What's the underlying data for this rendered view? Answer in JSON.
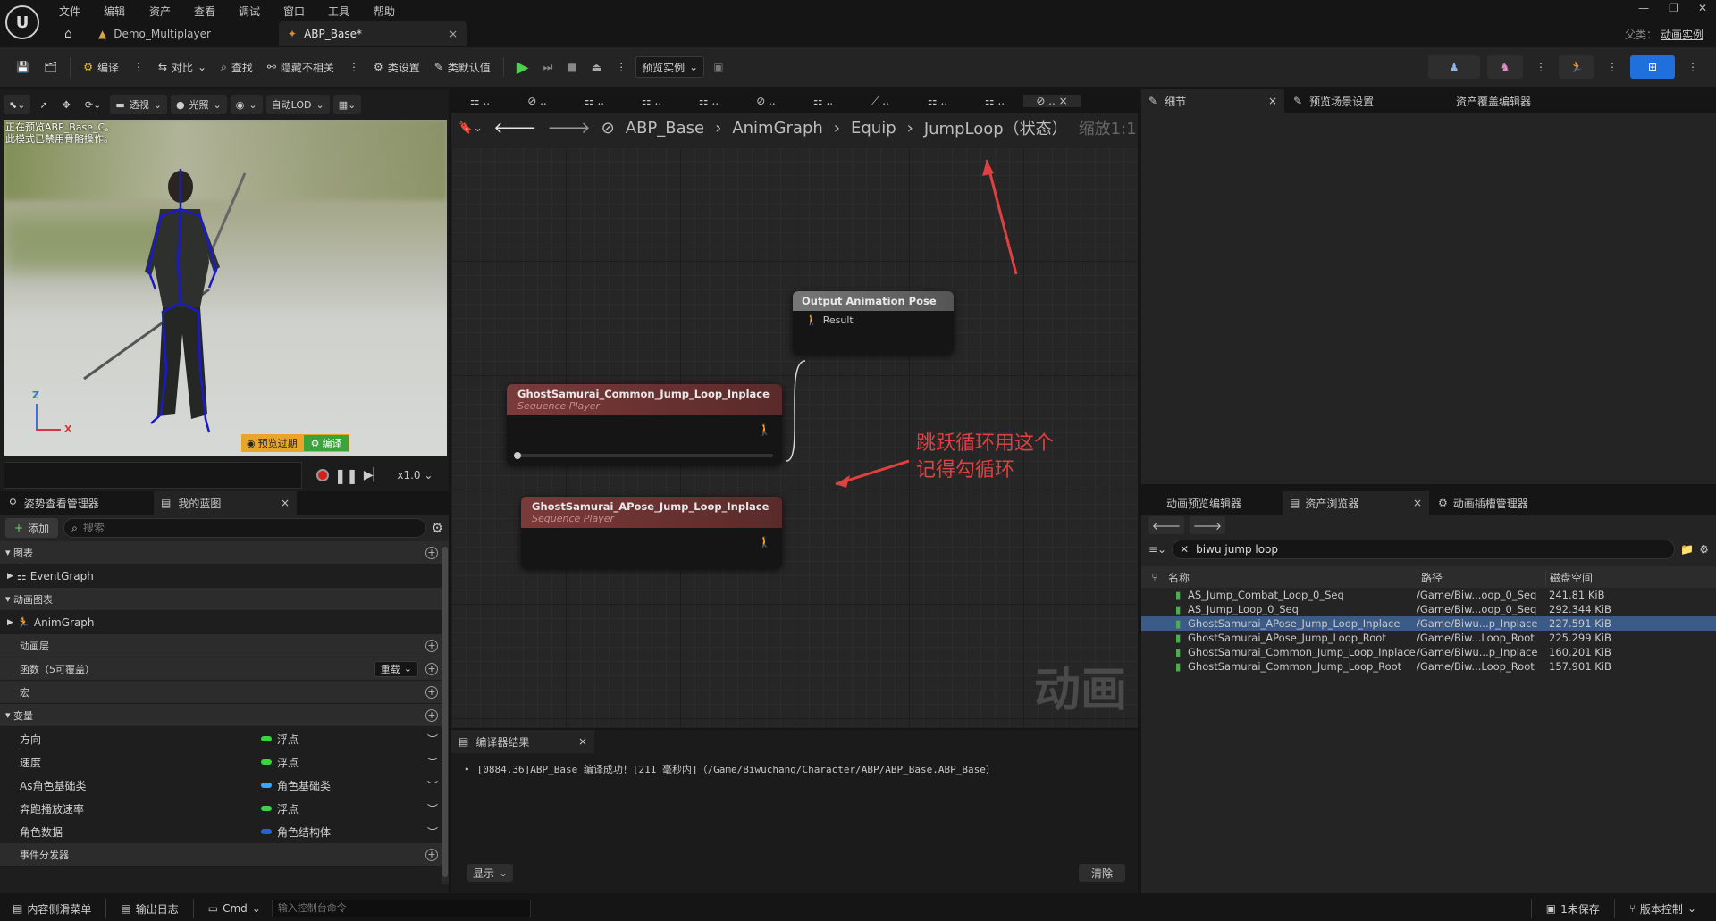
{
  "menu": [
    "文件",
    "编辑",
    "资产",
    "查看",
    "调试",
    "窗口",
    "工具",
    "帮助"
  ],
  "tabs": [
    {
      "label": "Demo_Multiplayer"
    },
    {
      "label": "ABP_Base*"
    }
  ],
  "parent_class": {
    "label": "父类：",
    "value": "动画实例"
  },
  "toolbar": {
    "compile": "编译",
    "diff": "对比",
    "find": "查找",
    "hide_unrelated": "隐藏不相关",
    "class_settings": "类设置",
    "class_defaults": "类默认值",
    "preview_instance": "预览实例"
  },
  "viewport": {
    "perspective": "透视",
    "lighting": "光照",
    "lod": "自动LOD",
    "overlay_line1": "正在预览ABP_Base_C。",
    "overlay_line2": "此模式已禁用骨骼操作。",
    "preview_expired": "预览过期",
    "compile_badge": "编译",
    "speed": "x1.0",
    "axis_z": "Z",
    "axis_x": "X"
  },
  "left_tabs": {
    "pose_watch": "姿势查看管理器",
    "my_blueprint": "我的蓝图"
  },
  "my_blueprint": {
    "add": "添加",
    "search_placeholder": "搜索",
    "graphs": "图表",
    "event_graph": "EventGraph",
    "anim_graphs": "动画图表",
    "anim_graph": "AnimGraph",
    "anim_layers": "动画层",
    "functions": "函数（5可覆盖）",
    "override": "重载",
    "macros": "宏",
    "variables": "变量",
    "event_dispatchers": "事件分发器",
    "vars": [
      {
        "name": "方向",
        "type": "浮点",
        "color": "#3fd13f"
      },
      {
        "name": "速度",
        "type": "浮点",
        "color": "#3fd13f"
      },
      {
        "name": "As角色基础类",
        "type": "角色基础类",
        "color": "#3aa6ff"
      },
      {
        "name": "奔跑播放速率",
        "type": "浮点",
        "color": "#3fd13f"
      },
      {
        "name": "角色数据",
        "type": "角色结构体",
        "color": "#2b5fd9"
      }
    ]
  },
  "graph": {
    "breadcrumb": [
      "ABP_Base",
      "AnimGraph",
      "Equip",
      "JumpLoop（状态）"
    ],
    "zoom": "缩放1:1",
    "watermark": "动画",
    "output_node": {
      "title": "Output Animation Pose",
      "pin": "Result"
    },
    "node1": {
      "title": "GhostSamurai_Common_Jump_Loop_Inplace",
      "subtitle": "Sequence Player"
    },
    "node2": {
      "title": "GhostSamurai_APose_Jump_Loop_Inplace",
      "subtitle": "Sequence Player"
    },
    "annotation_line1": "跳跃循环用这个",
    "annotation_line2": "记得勾循环"
  },
  "compiler": {
    "tab": "编译器结果",
    "message": "[0884.36]ABP_Base 编译成功！[211 毫秒内]（/Game/Biwuchang/Character/ABP/ABP_Base.ABP_Base）",
    "show": "显示",
    "clear": "清除"
  },
  "right_tabs": {
    "details": "细节",
    "preview_scene": "预览场景设置",
    "asset_override": "资产覆盖编辑器"
  },
  "bottom_right_tabs": {
    "anim_preview": "动画预览编辑器",
    "asset_browser": "资产浏览器",
    "anim_slot": "动画插槽管理器"
  },
  "asset_browser": {
    "search": "biwu jump loop",
    "columns": [
      "名称",
      "路径",
      "磁盘空间"
    ],
    "rows": [
      {
        "name": "AS_Jump_Combat_Loop_0_Seq",
        "path": "/Game/Biw...oop_0_Seq",
        "size": "241.81 KiB"
      },
      {
        "name": "AS_Jump_Loop_0_Seq",
        "path": "/Game/Biw...oop_0_Seq",
        "size": "292.344 KiB"
      },
      {
        "name": "GhostSamurai_APose_Jump_Loop_Inplace",
        "path": "/Game/Biwu...p_Inplace",
        "size": "227.591 KiB",
        "selected": true
      },
      {
        "name": "GhostSamurai_APose_Jump_Loop_Root",
        "path": "/Game/Biw...Loop_Root",
        "size": "225.299 KiB"
      },
      {
        "name": "GhostSamurai_Common_Jump_Loop_Inplace",
        "path": "/Game/Biwu...p_Inplace",
        "size": "160.201 KiB"
      },
      {
        "name": "GhostSamurai_Common_Jump_Loop_Root",
        "path": "/Game/Biw...Loop_Root",
        "size": "157.901 KiB"
      }
    ]
  },
  "statusbar": {
    "content_drawer": "内容侧滑菜单",
    "output_log": "输出日志",
    "cmd": "Cmd",
    "console_placeholder": "输入控制台命令",
    "unsaved": "1未保存",
    "source_control": "版本控制"
  }
}
